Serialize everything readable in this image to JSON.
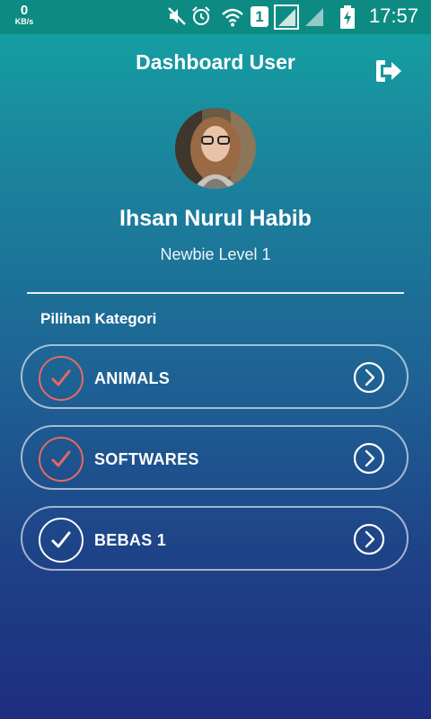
{
  "status_bar": {
    "net_speed_value": "0",
    "net_speed_unit": "KB/s",
    "sim_label": "1",
    "time": "17:57",
    "icons": [
      "mute-icon",
      "alarm-icon",
      "wifi-icon",
      "sim-icon",
      "signal-icon",
      "signal-icon",
      "battery-charging-icon"
    ]
  },
  "header": {
    "title": "Dashboard User",
    "logout_icon": "logout-icon"
  },
  "profile": {
    "name": "Ihsan Nurul Habib",
    "level": "Newbie Level 1"
  },
  "categories_section": {
    "title": "Pilihan Kategori",
    "items": [
      {
        "label": "ANIMALS",
        "check_color": "#e56a62"
      },
      {
        "label": "SOFTWARES",
        "check_color": "#e56a62"
      },
      {
        "label": "BEBAS 1",
        "check_color": "#ffffff"
      }
    ]
  },
  "colors": {
    "status_bar_bg": "#0d8b82",
    "gradient_top": "#12a6a3",
    "gradient_bottom": "#1e2d80",
    "check_accent": "#e56a62"
  }
}
